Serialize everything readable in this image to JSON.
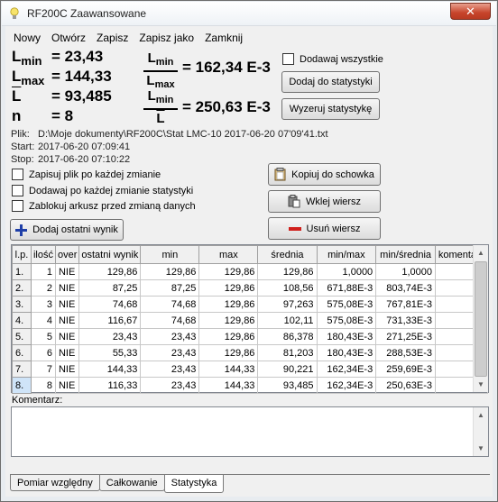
{
  "window": {
    "title": "RF200C Zaawansowane",
    "close_label": "✕"
  },
  "menu": [
    "Nowy",
    "Otwórz",
    "Zapisz",
    "Zapisz jako",
    "Zamknij"
  ],
  "stats": {
    "lmin_label": "L",
    "lmin_sub": "min",
    "lmin_value": "= 23,43",
    "lmax_label": "L",
    "lmax_sub": "max",
    "lmax_value": "= 144,33",
    "lavg_label": "L",
    "lavg_value": "= 93,485",
    "n_label": "n",
    "n_value": "= 8"
  },
  "ratios": {
    "r1_num": "L",
    "r1_num_sub": "min",
    "r1_den": "L",
    "r1_den_sub": "max",
    "r1_value": "= 162,34 E-3",
    "r2_num": "L",
    "r2_num_sub": "min",
    "r2_den": "L",
    "r2_value": "= 250,63 E-3"
  },
  "controls": {
    "add_all_label": "Dodawaj wszystkie",
    "add_to_stats_label": "Dodaj do statystyki",
    "reset_stats_label": "Wyzeruj statystykę",
    "copy_clipboard_label": "Kopiuj do schowka",
    "paste_row_label": "Wklej wiersz",
    "delete_row_label": "Usuń wiersz",
    "add_last_result_label": "Dodaj ostatni wynik"
  },
  "file_info": {
    "file_key": "Plik:",
    "file_value": "D:\\Moje dokumenty\\RF200C\\Stat LMC-10 2017-06-20 07'09'41.txt",
    "start_key": "Start:",
    "start_value": "2017-06-20 07:09:41",
    "stop_key": "Stop:",
    "stop_value": "2017-06-20 07:10:22"
  },
  "options": [
    "Zapisuj plik po każdej zmianie",
    "Dodawaj po każdej zmianie statystyki",
    "Zablokuj arkusz przed zmianą danych"
  ],
  "table": {
    "headers": [
      "l.p.",
      "ilość",
      "over",
      "ostatni wynik",
      "min",
      "max",
      "średnia",
      "min/max",
      "min/średnia",
      "komentarz"
    ],
    "rows": [
      [
        "1.",
        "1",
        "NIE",
        "129,86",
        "129,86",
        "129,86",
        "129,86",
        "1,0000",
        "1,0000",
        ""
      ],
      [
        "2.",
        "2",
        "NIE",
        "87,25",
        "87,25",
        "129,86",
        "108,56",
        "671,88E-3",
        "803,74E-3",
        ""
      ],
      [
        "3.",
        "3",
        "NIE",
        "74,68",
        "74,68",
        "129,86",
        "97,263",
        "575,08E-3",
        "767,81E-3",
        ""
      ],
      [
        "4.",
        "4",
        "NIE",
        "116,67",
        "74,68",
        "129,86",
        "102,11",
        "575,08E-3",
        "731,33E-3",
        ""
      ],
      [
        "5.",
        "5",
        "NIE",
        "23,43",
        "23,43",
        "129,86",
        "86,378",
        "180,43E-3",
        "271,25E-3",
        ""
      ],
      [
        "6.",
        "6",
        "NIE",
        "55,33",
        "23,43",
        "129,86",
        "81,203",
        "180,43E-3",
        "288,53E-3",
        ""
      ],
      [
        "7.",
        "7",
        "NIE",
        "144,33",
        "23,43",
        "144,33",
        "90,221",
        "162,34E-3",
        "259,69E-3",
        ""
      ],
      [
        "8.",
        "8",
        "NIE",
        "116,33",
        "23,43",
        "144,33",
        "93,485",
        "162,34E-3",
        "250,63E-3",
        ""
      ]
    ]
  },
  "comment": {
    "label": "Komentarz:",
    "value": ""
  },
  "tabs": [
    "Pomiar względny",
    "Całkowanie",
    "Statystyka"
  ],
  "active_tab": "Statystyka",
  "colors": {
    "add_icon": "#1f3fa8",
    "delete_icon": "#d0201c",
    "selected_row": "#cfe4f8"
  }
}
